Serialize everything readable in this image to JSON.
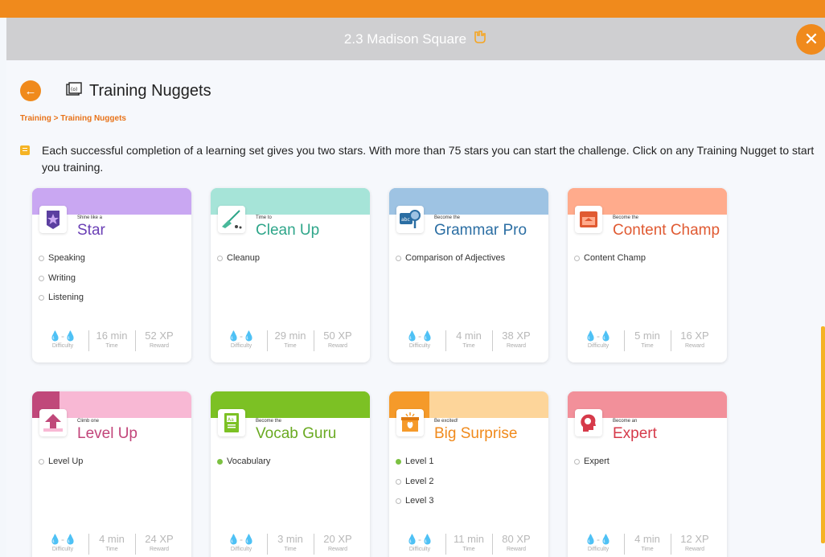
{
  "window": {
    "title": "2.3 Madison Square",
    "title_icon": "hand-pointer-icon",
    "close_icon": "close-icon"
  },
  "header": {
    "title": "Training Nuggets",
    "back_icon": "arrow-left-icon",
    "page_icon": "training-book-icon"
  },
  "breadcrumb": "Training > Training Nuggets",
  "info": "Each successful completion of a learning set gives you two stars. With more than 75 stars you can start the challenge. Click on any Training Nugget to start you training.",
  "colors": {
    "accent": "#f08a1c"
  },
  "stat_labels": {
    "difficulty": "Difficulty",
    "time": "Time",
    "reward": "Reward",
    "difficulty_glyph": "💧-💧"
  },
  "cards": [
    {
      "subtitle": "Shine like a",
      "title": "Star",
      "title_color": "#6a3fb5",
      "head_color": "#c9a7f2",
      "accent_color": "#c9a7f2",
      "icon": "star-icon",
      "items": [
        {
          "label": "Speaking",
          "done": false
        },
        {
          "label": "Writing",
          "done": false
        },
        {
          "label": "Listening",
          "done": false
        }
      ],
      "time": "16 min",
      "xp": "52 XP"
    },
    {
      "subtitle": "Time to",
      "title": "Clean Up",
      "title_color": "#2fa68a",
      "head_color": "#a6e4d8",
      "accent_color": "#a6e4d8",
      "icon": "broom-icon",
      "items": [
        {
          "label": "Cleanup",
          "done": false
        }
      ],
      "time": "29 min",
      "xp": "50 XP"
    },
    {
      "subtitle": "Become the",
      "title": "Grammar Pro",
      "title_color": "#2b6ea3",
      "head_color": "#9ec3e3",
      "accent_color": "#9ec3e3",
      "icon": "magnifier-icon",
      "items": [
        {
          "label": "Comparison of Adjectives",
          "done": false
        }
      ],
      "time": "4 min",
      "xp": "38 XP"
    },
    {
      "subtitle": "Become the",
      "title": "Content Champ",
      "title_color": "#e05a32",
      "head_color": "#ffab8c",
      "accent_color": "#ffab8c",
      "icon": "box-icon",
      "items": [
        {
          "label": "Content Champ",
          "done": false
        }
      ],
      "time": "5 min",
      "xp": "16 XP"
    },
    {
      "subtitle": "Climb one",
      "title": "Level Up",
      "title_color": "#c2457a",
      "head_color": "#f8b8d4",
      "accent_color": "#c0487a",
      "icon": "arrow-up-icon",
      "items": [
        {
          "label": "Level Up",
          "done": false
        }
      ],
      "time": "4 min",
      "xp": "24 XP"
    },
    {
      "subtitle": "Become the",
      "title": "Vocab Guru",
      "title_color": "#6aaa22",
      "head_color": "#7cc124",
      "accent_color": "#7cc124",
      "icon": "book-icon",
      "items": [
        {
          "label": "Vocabulary",
          "done": true
        }
      ],
      "time": "3 min",
      "xp": "20 XP"
    },
    {
      "subtitle": "Be excited!",
      "title": "Big Surprise",
      "title_color": "#f08a1c",
      "head_color": "#fdd59a",
      "accent_color": "#f59a2a",
      "icon": "gift-icon",
      "items": [
        {
          "label": "Level 1",
          "done": true
        },
        {
          "label": "Level 2",
          "done": false
        },
        {
          "label": "Level 3",
          "done": false
        }
      ],
      "time": "11 min",
      "xp": "80 XP"
    },
    {
      "subtitle": "Become an",
      "title": "Expert",
      "title_color": "#d63a4a",
      "head_color": "#f2909a",
      "accent_color": "#f2909a",
      "icon": "bulb-head-icon",
      "items": [
        {
          "label": "Expert",
          "done": false
        }
      ],
      "time": "4 min",
      "xp": "12 XP"
    }
  ]
}
